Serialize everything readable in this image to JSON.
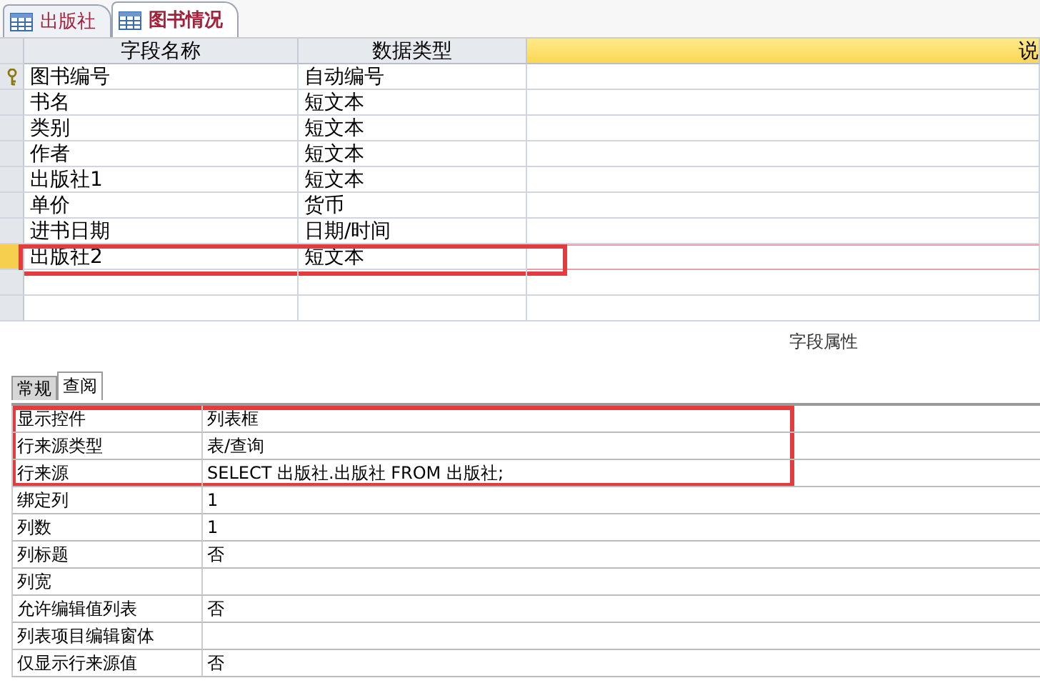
{
  "tabs": [
    {
      "label": "出版社",
      "selected": false
    },
    {
      "label": "图书情况",
      "selected": true
    }
  ],
  "design_grid": {
    "columns": [
      "字段名称",
      "数据类型",
      "说"
    ],
    "rows": [
      {
        "field_name": "图书编号",
        "data_type": "自动编号",
        "primary_key": true,
        "selected": false,
        "highlighted": false
      },
      {
        "field_name": "书名",
        "data_type": "短文本",
        "primary_key": false,
        "selected": false,
        "highlighted": false
      },
      {
        "field_name": "类别",
        "data_type": "短文本",
        "primary_key": false,
        "selected": false,
        "highlighted": false
      },
      {
        "field_name": "作者",
        "data_type": "短文本",
        "primary_key": false,
        "selected": false,
        "highlighted": false
      },
      {
        "field_name": "出版社1",
        "data_type": "短文本",
        "primary_key": false,
        "selected": false,
        "highlighted": false
      },
      {
        "field_name": "单价",
        "data_type": "货币",
        "primary_key": false,
        "selected": false,
        "highlighted": false
      },
      {
        "field_name": "进书日期",
        "data_type": "日期/时间",
        "primary_key": false,
        "selected": false,
        "highlighted": false
      },
      {
        "field_name": "出版社2",
        "data_type": "短文本",
        "primary_key": false,
        "selected": true,
        "highlighted": true
      }
    ]
  },
  "field_properties": {
    "title": "字段属性",
    "tabs": [
      {
        "label": "常规",
        "selected": false
      },
      {
        "label": "查阅",
        "selected": true
      }
    ],
    "rows": [
      {
        "label": "显示控件",
        "value": "列表框",
        "highlighted": true
      },
      {
        "label": "行来源类型",
        "value": "表/查询",
        "highlighted": true
      },
      {
        "label": "行来源",
        "value": "SELECT 出版社.出版社 FROM 出版社;",
        "highlighted": true
      },
      {
        "label": "绑定列",
        "value": "1",
        "highlighted": false
      },
      {
        "label": "列数",
        "value": "1",
        "highlighted": false
      },
      {
        "label": "列标题",
        "value": "否",
        "highlighted": false
      },
      {
        "label": "列宽",
        "highlighted": false
      },
      {
        "label": "允许编辑值列表",
        "value": "否",
        "highlighted": false
      },
      {
        "label": "列表项目编辑窗体",
        "highlighted": false
      },
      {
        "label": "仅显示行来源值",
        "value": "否",
        "highlighted": false
      }
    ]
  }
}
